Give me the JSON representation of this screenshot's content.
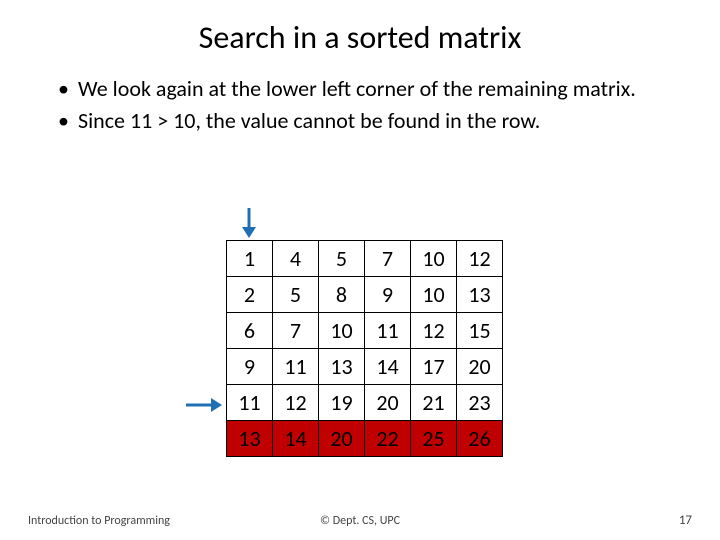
{
  "title": "Search in a sorted matrix",
  "bullets": [
    "We look again at the lower left corner of the remaining matrix.",
    "Since 11 > 10, the value cannot be found in the row."
  ],
  "matrix": {
    "rows": [
      [
        1,
        4,
        5,
        7,
        10,
        12
      ],
      [
        2,
        5,
        8,
        9,
        10,
        13
      ],
      [
        6,
        7,
        10,
        11,
        12,
        15
      ],
      [
        9,
        11,
        13,
        14,
        17,
        20
      ],
      [
        11,
        12,
        19,
        20,
        21,
        23
      ],
      [
        13,
        14,
        20,
        22,
        25,
        26
      ]
    ],
    "highlight_row_index": 5,
    "arrow_down_col": 0,
    "arrow_right_row": 4
  },
  "footer": {
    "left": "Introduction to Programming",
    "center": "© Dept. CS, UPC",
    "right": "17"
  },
  "colors": {
    "highlight": "#c00000",
    "arrow": "#1f6fb3"
  }
}
